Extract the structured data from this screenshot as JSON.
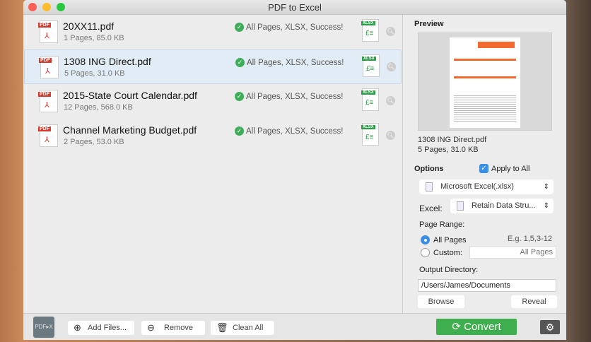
{
  "window": {
    "title": "PDF to Excel"
  },
  "files": [
    {
      "name": "20XX11.pdf",
      "meta": "1 Pages, 85.0 KB",
      "status": "All Pages, XLSX, Success!"
    },
    {
      "name": "1308 ING Direct.pdf",
      "meta": "5 Pages, 31.0 KB",
      "status": "All Pages, XLSX, Success!",
      "selected": true
    },
    {
      "name": "2015-State Court Calendar.pdf",
      "meta": "12 Pages, 568.0 KB",
      "status": "All Pages, XLSX, Success!"
    },
    {
      "name": "Channel Marketing Budget.pdf",
      "meta": "2 Pages, 53.0 KB",
      "status": "All Pages, XLSX, Success!"
    }
  ],
  "icons": {
    "pdf_tag": "PDF",
    "xls_tag": "XLSX"
  },
  "preview": {
    "heading": "Preview",
    "name": "1308 ING Direct.pdf",
    "meta": "5 Pages, 31.0 KB"
  },
  "options": {
    "heading": "Options",
    "apply_all": "Apply to All",
    "apply_all_checked": true,
    "format": "Microsoft Excel(.xlsx)",
    "excel_label": "Excel:",
    "excel_mode": "Retain Data Stru...",
    "page_range_label": "Page Range:",
    "all_pages": "All Pages",
    "example": "E.g. 1,5,3-12",
    "custom": "Custom:",
    "custom_placeholder": "All Pages",
    "output_label": "Output Directory:",
    "output_dir": "/Users/James/Documents",
    "browse": "Browse",
    "reveal": "Reveal"
  },
  "toolbar": {
    "add": "Add Files...",
    "remove": "Remove",
    "clean": "Clean All",
    "convert": "Convert"
  },
  "colors": {
    "accent": "#3fae4e",
    "selected_row": "#e2ecf6"
  }
}
